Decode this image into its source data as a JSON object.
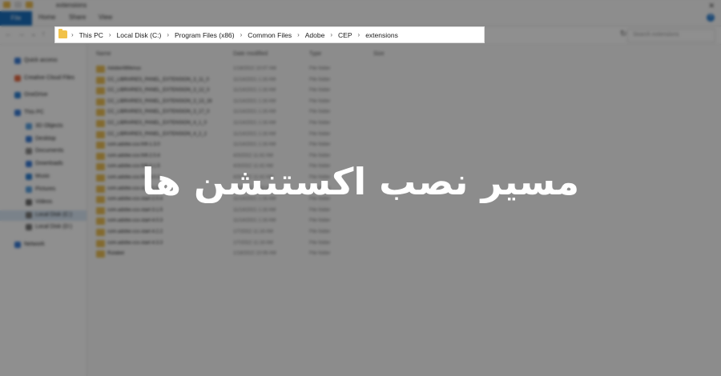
{
  "ribbon": {
    "file_tab": "File",
    "tabs": [
      "Home",
      "Share",
      "View"
    ],
    "window_title": "extensions",
    "help": "?"
  },
  "nav": {
    "search_placeholder": "Search extensions",
    "refresh": "↻"
  },
  "address_bar": {
    "segments": [
      "This PC",
      "Local Disk (C:)",
      "Program Files (x86)",
      "Common Files",
      "Adobe",
      "CEP",
      "extensions"
    ]
  },
  "sidebar": {
    "items": [
      "Quick access",
      "Creative Cloud Files",
      "OneDrive",
      "This PC",
      "3D Objects",
      "Desktop",
      "Documents",
      "Downloads",
      "Music",
      "Pictures",
      "Videos",
      "Local Disk (C:)",
      "Local Disk (D:)",
      "Network"
    ],
    "selected_index": 11
  },
  "columns": {
    "name": "Name",
    "date": "Date modified",
    "type": "Type",
    "size": "Size"
  },
  "files": [
    {
      "name": "AdobeAllMenus",
      "date": "1/18/2022 10:07 AM",
      "type": "File folder"
    },
    {
      "name": "CC_LIBRARIES_PANEL_EXTENSION_3_11_0",
      "date": "11/14/2021 1:16 AM",
      "type": "File folder"
    },
    {
      "name": "CC_LIBRARIES_PANEL_EXTENSION_3_12_0",
      "date": "11/14/2021 1:16 AM",
      "type": "File folder"
    },
    {
      "name": "CC_LIBRARIES_PANEL_EXTENSION_3_13_16",
      "date": "11/14/2021 1:16 AM",
      "type": "File folder"
    },
    {
      "name": "CC_LIBRARIES_PANEL_EXTENSION_3_17_0",
      "date": "11/14/2021 1:16 AM",
      "type": "File folder"
    },
    {
      "name": "CC_LIBRARIES_PANEL_EXTENSION_4_1_0",
      "date": "11/14/2021 1:16 AM",
      "type": "File folder"
    },
    {
      "name": "CC_LIBRARIES_PANEL_EXTENSION_4_2_2",
      "date": "11/14/2021 1:16 AM",
      "type": "File folder"
    },
    {
      "name": "com.adobe.ccx.fnft-1.3.0",
      "date": "11/14/2021 1:16 AM",
      "type": "File folder"
    },
    {
      "name": "com.adobe.ccx.fnft-2.0.4",
      "date": "4/3/2022 11:42 AM",
      "type": "File folder"
    },
    {
      "name": "com.adobe.ccx.fnft-3.1.5",
      "date": "4/3/2022 11:42 AM",
      "type": "File folder"
    },
    {
      "name": "com.adobe.ccx.fnft-4.0.3",
      "date": "4/3/2022 11:42 AM",
      "type": "File folder"
    },
    {
      "name": "com.adobe.ccx.start-1.3.0",
      "date": "4/3/2022 11:42 AM",
      "type": "File folder"
    },
    {
      "name": "com.adobe.ccx.start-2.0.4",
      "date": "11/14/2021 1:16 AM",
      "type": "File folder"
    },
    {
      "name": "com.adobe.ccx.start-3.1.5",
      "date": "11/14/2021 1:16 AM",
      "type": "File folder"
    },
    {
      "name": "com.adobe.ccx.start-4.0.3",
      "date": "11/14/2021 1:16 AM",
      "type": "File folder"
    },
    {
      "name": "com.adobe.ccx.start-4.2.2",
      "date": "1/7/2022 11:16 AM",
      "type": "File folder"
    },
    {
      "name": "com.adobe.ccx.start-4.3.3",
      "date": "1/7/2022 11:16 AM",
      "type": "File folder"
    },
    {
      "name": "Rutabet",
      "date": "1/18/2022 10:06 AM",
      "type": "File folder"
    }
  ],
  "heading": {
    "text": "مسیر نصب اکستنشن ها"
  },
  "colors": {
    "folder": "#f1c24a",
    "file_tab": "#1a6fbd",
    "selection": "#d9e8f7",
    "dim": "rgba(0,0,0,0.44)"
  }
}
